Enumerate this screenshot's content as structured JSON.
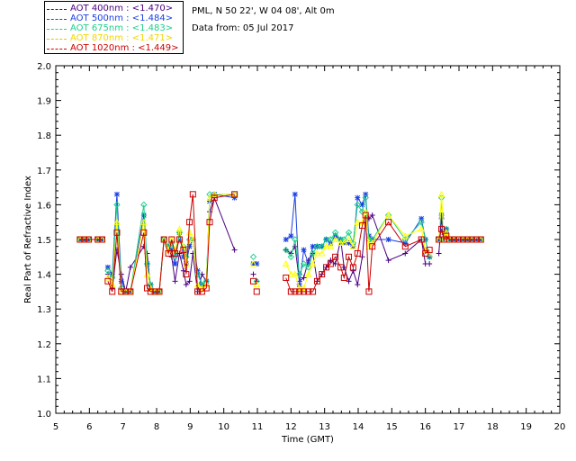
{
  "legend": [
    {
      "name": "AOT  400nm : <1.470>",
      "color": "#4b0082"
    },
    {
      "name": "AOT  500nm : <1.484>",
      "color": "#1a3fe0"
    },
    {
      "name": "AOT  675nm : <1.483>",
      "color": "#1ecf8c"
    },
    {
      "name": "AOT  870nm : <1.471>",
      "color": "#ffff00"
    },
    {
      "name": "AOT 1020nm : <1.449>",
      "color": "#cc0000"
    }
  ],
  "info": {
    "site": "PML, N 50 22', W 04 08', Alt 0m",
    "date": "Data from: 05 Jul 2017"
  },
  "chart_data": {
    "type": "line",
    "xlabel": "Time (GMT)",
    "ylabel": "Real Part of Refractive Index",
    "xlim": [
      5,
      20
    ],
    "ylim": [
      1.0,
      2.0
    ],
    "xticks": [
      "5",
      "6",
      "7",
      "8",
      "9",
      "10",
      "11",
      "12",
      "13",
      "14",
      "15",
      "16",
      "17",
      "18",
      "19",
      "20"
    ],
    "yticks": [
      "1.0",
      "1.1",
      "1.2",
      "1.3",
      "1.4",
      "1.5",
      "1.6",
      "1.7",
      "1.8",
      "1.9",
      "2.0"
    ],
    "x": [
      5.72,
      5.85,
      5.98,
      6.25,
      6.38,
      6.55,
      6.68,
      6.82,
      6.95,
      7.08,
      7.22,
      7.62,
      7.72,
      7.82,
      7.95,
      8.08,
      8.22,
      8.35,
      8.45,
      8.55,
      8.68,
      8.8,
      8.88,
      8.98,
      9.08,
      9.22,
      9.35,
      9.48,
      9.58,
      9.72,
      10.32,
      10.88,
      10.98,
      11.85,
      12.0,
      12.12,
      12.25,
      12.38,
      12.52,
      12.65,
      12.78,
      12.92,
      13.05,
      13.18,
      13.32,
      13.48,
      13.58,
      13.72,
      13.85,
      13.98,
      14.12,
      14.22,
      14.32,
      14.42,
      14.9,
      15.4,
      15.88,
      16.0,
      16.12,
      16.4,
      16.48,
      16.55,
      16.62,
      16.72,
      16.85,
      16.98,
      17.12,
      17.25,
      17.38,
      17.52,
      17.65
    ],
    "series": [
      {
        "name": "AOT  400nm : <1.470>",
        "values": [
          1.5,
          1.5,
          1.5,
          1.5,
          1.5,
          1.4,
          1.36,
          1.47,
          1.4,
          1.35,
          1.42,
          1.48,
          1.46,
          1.36,
          1.35,
          1.35,
          1.5,
          1.48,
          1.45,
          1.38,
          1.46,
          1.41,
          1.37,
          1.38,
          1.46,
          1.35,
          1.4,
          1.38,
          1.58,
          1.62,
          1.47,
          1.4,
          1.38,
          1.47,
          1.46,
          1.48,
          1.38,
          1.39,
          1.44,
          1.46,
          1.38,
          1.4,
          1.42,
          1.44,
          1.43,
          1.5,
          1.42,
          1.38,
          1.41,
          1.37,
          1.45,
          1.55,
          1.56,
          1.57,
          1.44,
          1.46,
          1.5,
          1.43,
          1.43,
          1.46,
          1.56,
          1.5,
          1.52,
          1.5,
          1.5,
          1.5,
          1.5,
          1.5,
          1.5,
          1.5,
          1.5
        ]
      },
      {
        "name": "AOT  500nm : <1.484>",
        "values": [
          1.5,
          1.5,
          1.5,
          1.5,
          1.5,
          1.42,
          1.4,
          1.63,
          1.38,
          1.35,
          1.35,
          1.57,
          1.43,
          1.37,
          1.35,
          1.35,
          1.5,
          1.48,
          1.47,
          1.43,
          1.52,
          1.45,
          1.43,
          1.48,
          1.5,
          1.41,
          1.37,
          1.38,
          1.61,
          1.63,
          1.62,
          1.43,
          1.43,
          1.5,
          1.51,
          1.63,
          1.37,
          1.47,
          1.43,
          1.48,
          1.48,
          1.48,
          1.5,
          1.49,
          1.51,
          1.5,
          1.49,
          1.49,
          1.48,
          1.62,
          1.6,
          1.63,
          1.51,
          1.5,
          1.5,
          1.49,
          1.56,
          1.5,
          1.45,
          1.5,
          1.57,
          1.52,
          1.53,
          1.5,
          1.5,
          1.5,
          1.5,
          1.5,
          1.5,
          1.5,
          1.5
        ]
      },
      {
        "name": "AOT  675nm : <1.483>",
        "values": [
          1.5,
          1.5,
          1.5,
          1.5,
          1.5,
          1.41,
          1.39,
          1.6,
          1.36,
          1.35,
          1.35,
          1.6,
          1.43,
          1.37,
          1.35,
          1.35,
          1.5,
          1.48,
          1.49,
          1.45,
          1.52,
          1.48,
          1.45,
          1.5,
          1.5,
          1.4,
          1.37,
          1.38,
          1.63,
          1.63,
          1.63,
          1.45,
          1.38,
          1.47,
          1.45,
          1.5,
          1.4,
          1.43,
          1.42,
          1.46,
          1.48,
          1.48,
          1.5,
          1.5,
          1.52,
          1.5,
          1.5,
          1.52,
          1.49,
          1.6,
          1.58,
          1.62,
          1.5,
          1.5,
          1.57,
          1.5,
          1.55,
          1.5,
          1.45,
          1.5,
          1.62,
          1.5,
          1.53,
          1.5,
          1.5,
          1.5,
          1.5,
          1.5,
          1.5,
          1.5,
          1.5
        ]
      },
      {
        "name": "AOT  870nm : <1.471>",
        "values": [
          1.5,
          1.5,
          1.5,
          1.5,
          1.5,
          1.39,
          1.37,
          1.55,
          1.35,
          1.35,
          1.35,
          1.55,
          1.4,
          1.36,
          1.35,
          1.35,
          1.5,
          1.47,
          1.5,
          1.47,
          1.53,
          1.48,
          1.43,
          1.52,
          1.5,
          1.37,
          1.36,
          1.37,
          1.62,
          1.63,
          1.63,
          1.43,
          1.37,
          1.43,
          1.4,
          1.4,
          1.36,
          1.36,
          1.4,
          1.43,
          1.46,
          1.46,
          1.48,
          1.48,
          1.5,
          1.49,
          1.49,
          1.5,
          1.48,
          1.55,
          1.55,
          1.58,
          1.48,
          1.49,
          1.57,
          1.51,
          1.53,
          1.47,
          1.46,
          1.5,
          1.63,
          1.5,
          1.52,
          1.5,
          1.5,
          1.5,
          1.5,
          1.5,
          1.5,
          1.5,
          1.5
        ]
      },
      {
        "name": "AOT 1020nm : <1.449>",
        "values": [
          1.5,
          1.5,
          1.5,
          1.5,
          1.5,
          1.38,
          1.35,
          1.52,
          1.35,
          1.35,
          1.35,
          1.52,
          1.36,
          1.35,
          1.35,
          1.35,
          1.5,
          1.46,
          1.5,
          1.46,
          1.5,
          1.47,
          1.4,
          1.55,
          1.63,
          1.35,
          1.35,
          1.36,
          1.55,
          1.62,
          1.63,
          1.38,
          1.35,
          1.39,
          1.35,
          1.35,
          1.35,
          1.35,
          1.35,
          1.35,
          1.38,
          1.4,
          1.42,
          1.43,
          1.45,
          1.42,
          1.39,
          1.45,
          1.42,
          1.46,
          1.54,
          1.57,
          1.35,
          1.48,
          1.55,
          1.48,
          1.5,
          1.46,
          1.47,
          1.5,
          1.53,
          1.5,
          1.51,
          1.5,
          1.5,
          1.5,
          1.5,
          1.5,
          1.5,
          1.5,
          1.5
        ]
      }
    ],
    "connected_until": [
      30,
      30,
      30,
      30,
      30
    ],
    "grid": false,
    "legend_position": "top-left, outside plot"
  }
}
